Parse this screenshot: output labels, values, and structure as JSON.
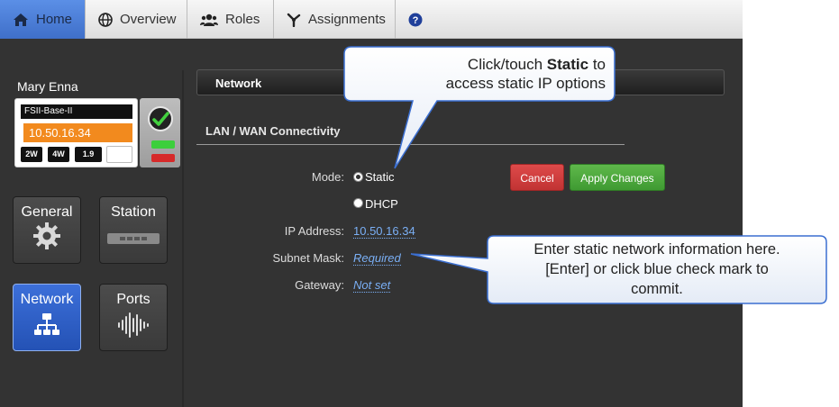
{
  "nav": {
    "tabs": [
      {
        "label": "Home",
        "icon": "home-icon"
      },
      {
        "label": "Overview",
        "icon": "globe-icon"
      },
      {
        "label": "Roles",
        "icon": "users-icon"
      },
      {
        "label": "Assignments",
        "icon": "assignments-icon"
      }
    ],
    "help_icon": "help-icon",
    "active_color": "#4a7fd8"
  },
  "sidebar": {
    "user_name": "Mary Enna",
    "device": {
      "name": "FSII-Base-II",
      "ip": "10.50.16.34",
      "chips": [
        "2W",
        "4W",
        "1.9"
      ]
    },
    "tiles": [
      {
        "label": "General",
        "icon": "gear-icon"
      },
      {
        "label": "Station",
        "icon": "station-icon"
      },
      {
        "label": "Network",
        "icon": "network-icon",
        "active": true
      },
      {
        "label": "Ports",
        "icon": "audio-wave-icon"
      }
    ]
  },
  "main": {
    "section_title": "Network",
    "subsection_title": "LAN / WAN Connectivity",
    "mode_label": "Mode:",
    "mode_options": [
      "Static",
      "DHCP"
    ],
    "mode_selected": "Static",
    "ip_label": "IP Address:",
    "ip_value": "10.50.16.34",
    "mask_label": "Subnet Mask:",
    "mask_value": "Required",
    "gateway_label": "Gateway:",
    "gateway_value": "Not set",
    "cancel_label": "Cancel",
    "apply_label": "Apply Changes"
  },
  "callouts": {
    "static_line1_pre": "Click/touch ",
    "static_line1_bold": "Static",
    "static_line1_post": " to",
    "static_line2": "access static IP options",
    "info_line1": "Enter static network information here.",
    "info_line2": "[Enter] or click blue check mark to",
    "info_line3": "commit."
  }
}
